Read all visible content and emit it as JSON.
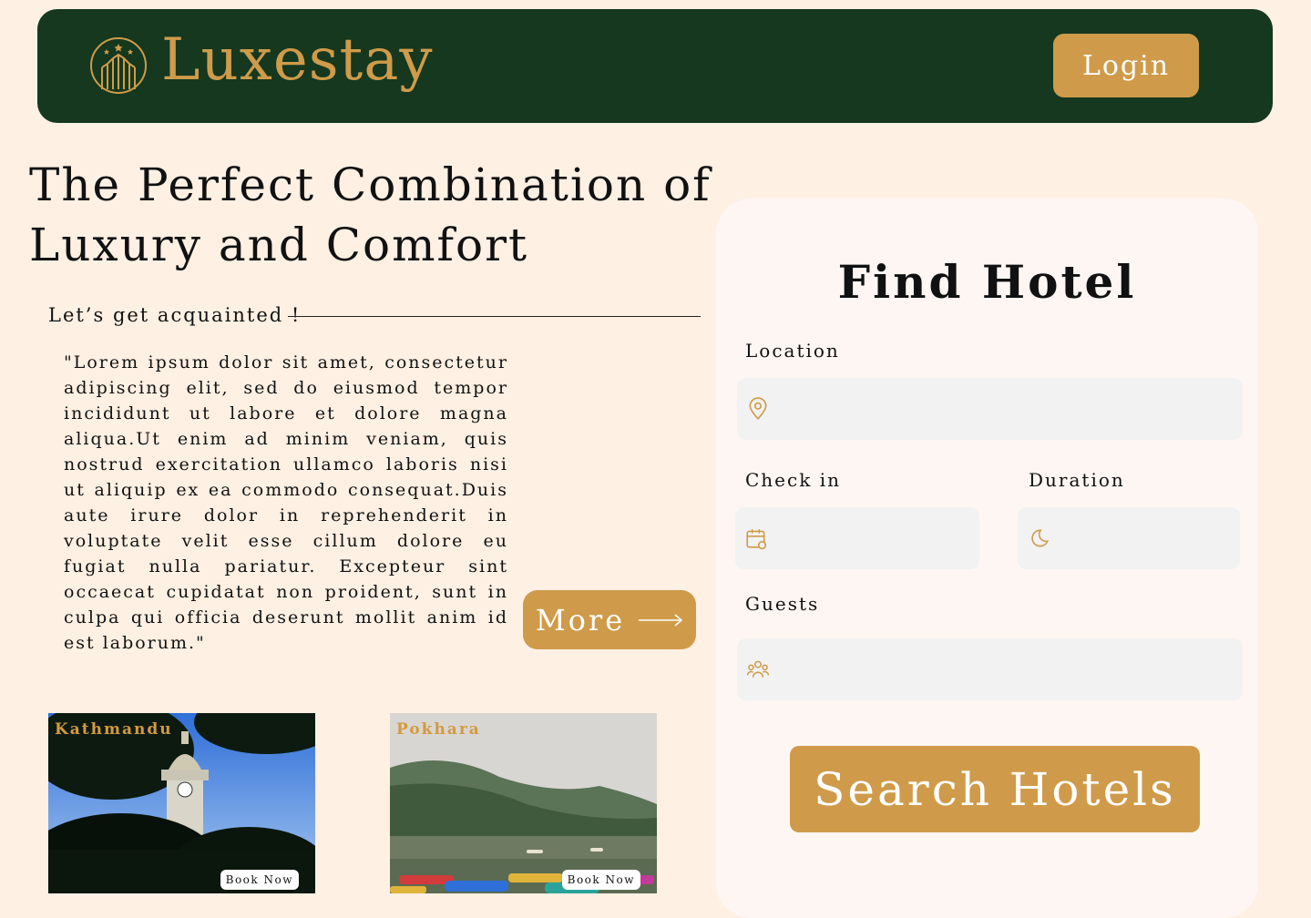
{
  "brand": "Luxestay",
  "header": {
    "login_label": "Login"
  },
  "hero": {
    "title": "The Perfect Combination of Luxury and Comfort",
    "subtitle": "Let’s get acquainted !",
    "body": "\"Lorem ipsum dolor sit amet, consectetur adipiscing elit, sed do eiusmod tempor incididunt ut labore et dolore magna aliqua.Ut enim ad minim veniam, quis nostrud exercitation ullamco laboris nisi ut aliquip ex ea commodo consequat.Duis aute irure dolor in reprehenderit in voluptate velit esse cillum dolore eu fugiat nulla pariatur. Excepteur sint occaecat cupidatat non proident, sunt in culpa qui officia deserunt mollit anim id est laborum.\"",
    "more_label": "More"
  },
  "destinations": [
    {
      "city": "Kathmandu",
      "book_label": "Book Now"
    },
    {
      "city": "Pokhara",
      "book_label": "Book Now"
    }
  ],
  "find_hotel": {
    "title": "Find Hotel",
    "location_label": "Location",
    "checkin_label": "Check in",
    "duration_label": "Duration",
    "guests_label": "Guests",
    "search_label": "Search Hotels",
    "icons": [
      "location-pin-icon",
      "calendar-icon",
      "moon-icon",
      "guests-icon"
    ]
  },
  "colors": {
    "background": "#fef0e3",
    "navbar": "#15381f",
    "accent": "#cf9b4a",
    "panel": "#fef6f2",
    "field": "#f2f2f2"
  }
}
